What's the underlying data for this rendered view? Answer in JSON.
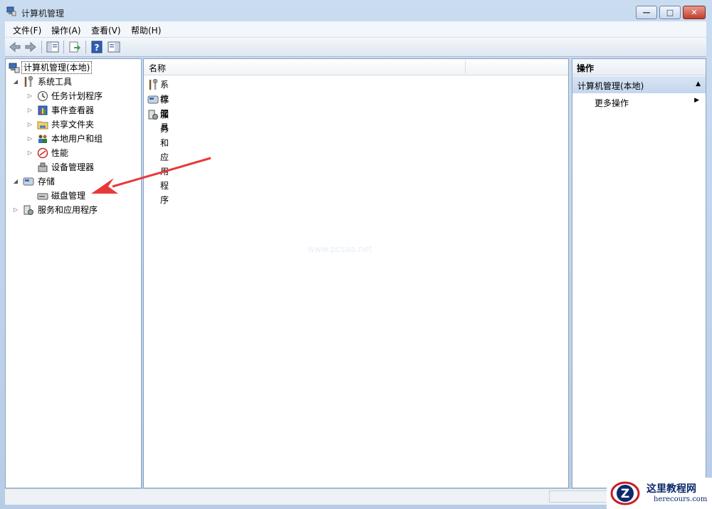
{
  "window": {
    "title": "计算机管理",
    "minimize_glyph": "—",
    "maximize_glyph": "□",
    "close_glyph": "✕"
  },
  "menu": [
    "文件(F)",
    "操作(A)",
    "查看(V)",
    "帮助(H)"
  ],
  "toolbar": {
    "buttons": [
      "back-arrow-icon",
      "forward-arrow-icon",
      "show-hide-tree-icon",
      "export-list-icon",
      "help-icon",
      "show-hide-action-pane-icon"
    ]
  },
  "tree": {
    "root": "计算机管理(本地)",
    "system_tools": "系统工具",
    "task_scheduler": "任务计划程序",
    "event_viewer": "事件查看器",
    "shared_folders": "共享文件夹",
    "local_users": "本地用户和组",
    "performance": "性能",
    "device_manager": "设备管理器",
    "storage": "存储",
    "disk_management": "磁盘管理",
    "services_apps": "服务和应用程序",
    "expanded_arrow": "◢",
    "collapsed_arrow": "▷"
  },
  "center": {
    "column_name": "名称",
    "items": [
      "系统工具",
      "存储",
      "服务和应用程序"
    ],
    "watermark": "www.pcsaa.net"
  },
  "actions": {
    "header": "操作",
    "group": "计算机管理(本地)",
    "group_caret": "▲",
    "more": "更多操作",
    "more_caret": "▶"
  },
  "logo": {
    "title": "这里教程网",
    "url": "herecours.com",
    "mark": "Z"
  },
  "colors": {
    "annotation_arrow": "#e63a3a",
    "logo_ring": "#c81d25",
    "logo_blue": "#0b2a6b"
  }
}
